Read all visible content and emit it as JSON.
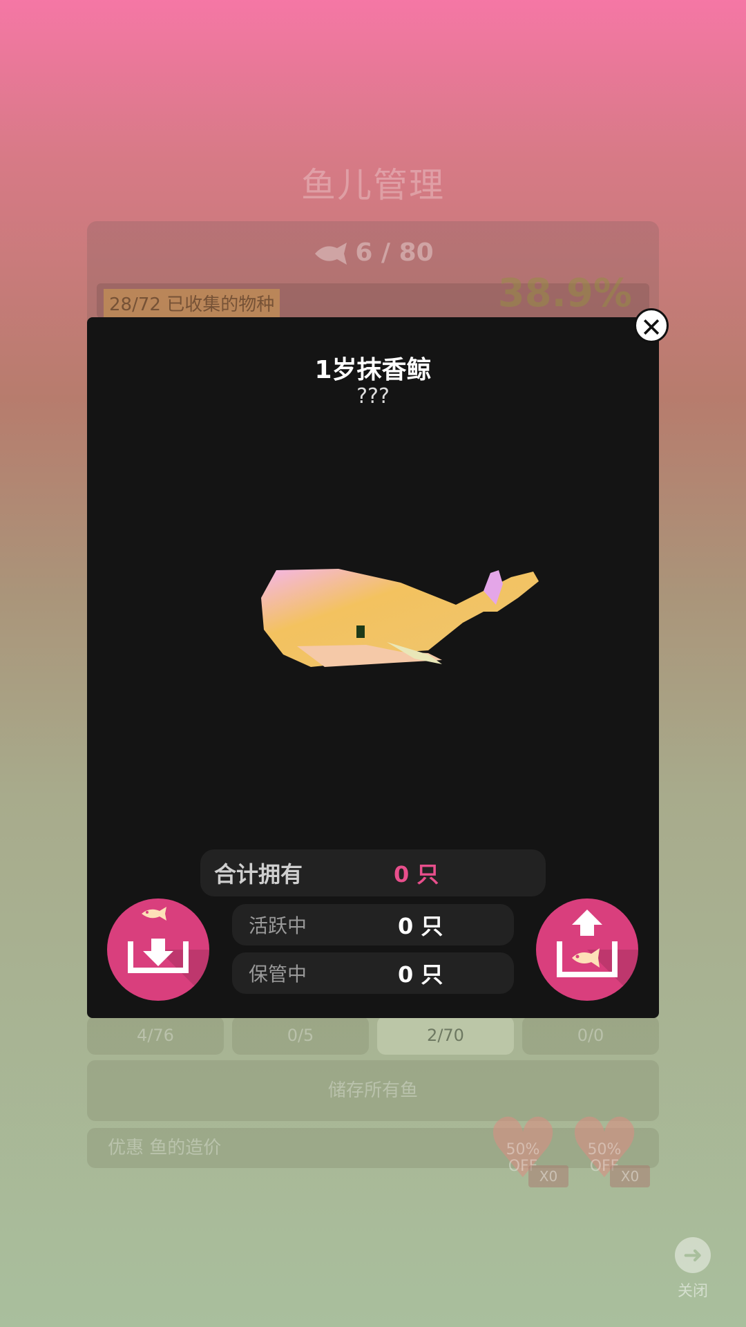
{
  "background": {
    "title": "鱼儿管理",
    "fish_count": "6 / 80",
    "collected_species": "28/72 已收集的物种",
    "collected_percent": "38.9%",
    "tabs": [
      "4/76",
      "0/5",
      "2/70",
      "0/0"
    ],
    "store_all_button": "储存所有鱼",
    "discount_label": "优惠 鱼的造价",
    "heart_offers": [
      {
        "label": "50%\nOFF",
        "badge": "X0"
      },
      {
        "label": "50%\nOFF",
        "badge": "X0"
      }
    ],
    "close_label": "关闭"
  },
  "modal": {
    "fish_name": "1岁抹香鲸",
    "fish_subtitle": "???",
    "stats": {
      "total_label": "合计拥有",
      "total_value": "0 只",
      "active_label": "活跃中",
      "active_value": "0 只",
      "storage_label": "保管中",
      "storage_value": "0 只"
    }
  },
  "colors": {
    "accent": "#d93f7d",
    "total_value": "#e84f8c",
    "modal_bg": "#141414"
  }
}
